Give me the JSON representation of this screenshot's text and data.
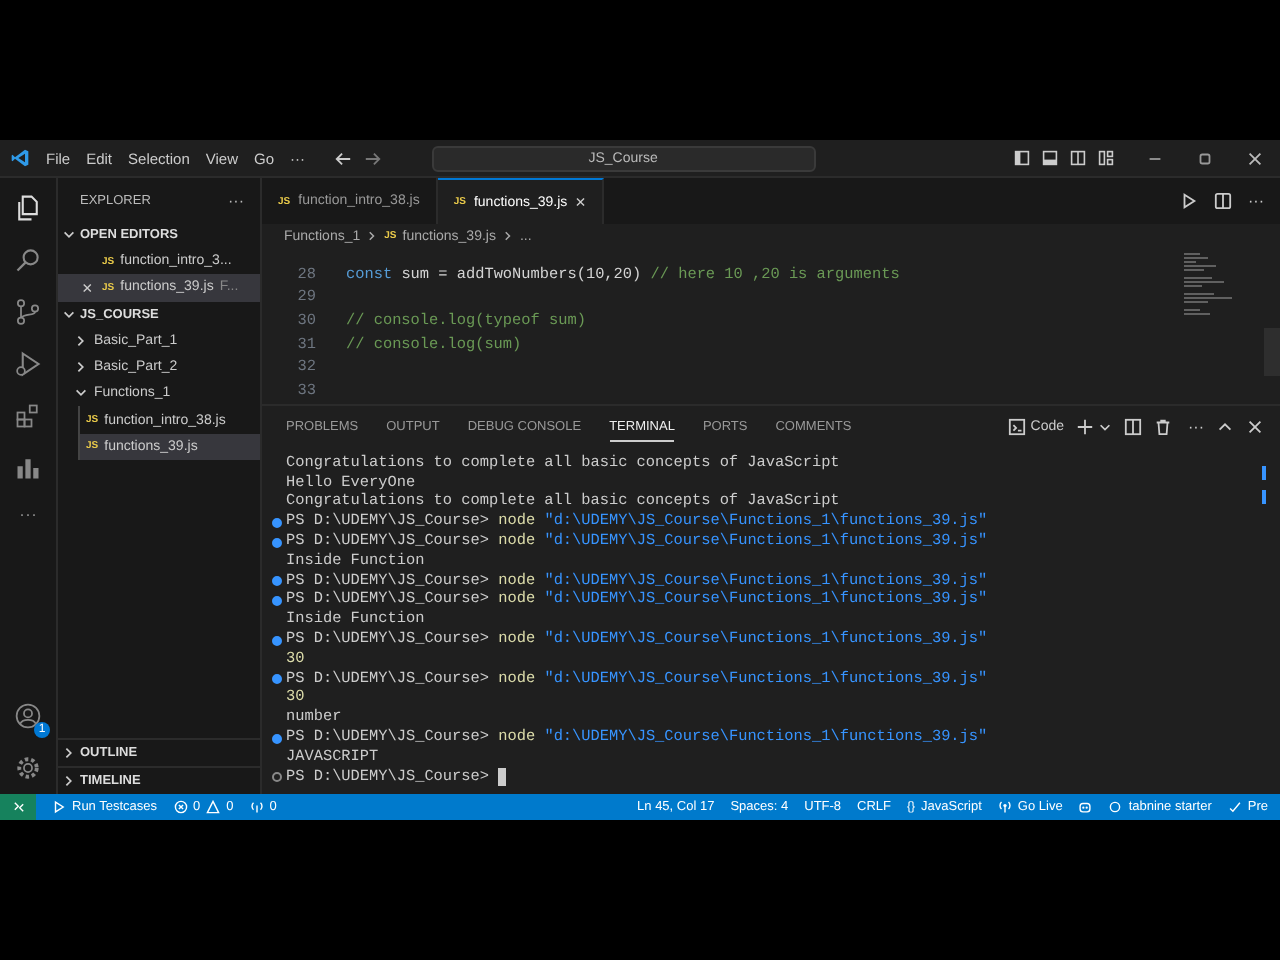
{
  "title_bar": {
    "menu": [
      "File",
      "Edit",
      "Selection",
      "View",
      "Go",
      "···"
    ],
    "search": "JS_Course"
  },
  "activity_more": "···",
  "sidebar": {
    "title": "EXPLORER",
    "more": "···",
    "sections": [
      {
        "label": "OPEN EDITORS",
        "expanded": true,
        "items": [
          {
            "icon": "JS",
            "name": "function_intro_3...",
            "selected": false
          },
          {
            "close": "×",
            "icon": "JS",
            "name": "functions_39.js",
            "detail": "F...",
            "selected": true
          }
        ]
      },
      {
        "label": "JS_COURSE",
        "expanded": true,
        "tree": [
          {
            "name": "Basic_Part_1",
            "kind": "folder",
            "expanded": false,
            "selected": false
          },
          {
            "name": "Basic_Part_2",
            "kind": "folder",
            "expanded": false,
            "selected": false
          },
          {
            "name": "Functions_1",
            "kind": "folder",
            "expanded": true,
            "selected": false,
            "children": [
              {
                "icon": "JS",
                "name": "function_intro_38.js",
                "kind": "file",
                "selected": false
              },
              {
                "icon": "JS",
                "name": "functions_39.js",
                "kind": "file",
                "selected": true
              }
            ]
          }
        ]
      }
    ],
    "bottom_sections": [
      {
        "label": "OUTLINE",
        "expanded": false
      },
      {
        "label": "TIMELINE",
        "expanded": false
      }
    ],
    "account_badge": "1"
  },
  "tabs": [
    {
      "icon": "JS",
      "label": "function_intro_38.js",
      "selected": false
    },
    {
      "icon": "JS",
      "label": "functions_39.js",
      "close": "×",
      "selected": true
    }
  ],
  "tab_bar_more": "···",
  "breadcrumbs": {
    "folder": "Functions_1",
    "icon": "JS",
    "file": "functions_39.js",
    "more": "..."
  },
  "editor": {
    "lines": [
      {
        "number": "28",
        "tokens": [
          {
            "kind": "keyword",
            "text": "const"
          },
          {
            "kind": "plain",
            "text": " sum = addTwoNumbers(10,20) "
          },
          {
            "kind": "comment",
            "text": "// here 10 ,20 is arguments"
          }
        ]
      },
      {
        "number": "29"
      },
      {
        "number": "30",
        "tokens": [
          {
            "kind": "comment",
            "text": "// console.log(typeof sum)"
          }
        ]
      },
      {
        "number": "31",
        "tokens": [
          {
            "kind": "comment",
            "text": "// console.log(sum)"
          }
        ]
      },
      {
        "number": "32"
      },
      {
        "number": "33"
      }
    ]
  },
  "panel": {
    "tabs": [
      {
        "label": "PROBLEMS",
        "selected": false
      },
      {
        "label": "OUTPUT",
        "selected": false
      },
      {
        "label": "DEBUG CONSOLE",
        "selected": false
      },
      {
        "label": "TERMINAL",
        "selected": true
      },
      {
        "label": "PORTS",
        "selected": false
      },
      {
        "label": "COMMENTS",
        "selected": false
      }
    ],
    "terminal_name": "Code",
    "more": "···",
    "terminal": [
      {
        "kind": "output",
        "text": "Congratulations to complete all basic concepts of JavaScript"
      },
      {
        "kind": "output",
        "text": "Hello EveryOne"
      },
      {
        "kind": "output",
        "text": "Congratulations to complete all basic concepts of JavaScript"
      },
      {
        "kind": "prompt",
        "done": true,
        "prompt": "PS D:\\UDEMY\\JS_Course>",
        "command": "node",
        "argument": "\"d:\\UDEMY\\JS_Course\\Functions_1\\functions_39.js\""
      },
      {
        "kind": "prompt",
        "done": true,
        "prompt": "PS D:\\UDEMY\\JS_Course>",
        "command": "node",
        "argument": "\"d:\\UDEMY\\JS_Course\\Functions_1\\functions_39.js\""
      },
      {
        "kind": "output",
        "text": "Inside Function"
      },
      {
        "kind": "prompt",
        "done": true,
        "prompt": "PS D:\\UDEMY\\JS_Course>",
        "command": "node",
        "argument": "\"d:\\UDEMY\\JS_Course\\Functions_1\\functions_39.js\""
      },
      {
        "kind": "prompt",
        "done": true,
        "prompt": "PS D:\\UDEMY\\JS_Course>",
        "command": "node",
        "argument": "\"d:\\UDEMY\\JS_Course\\Functions_1\\functions_39.js\""
      },
      {
        "kind": "output",
        "text": "Inside Function"
      },
      {
        "kind": "prompt",
        "done": true,
        "prompt": "PS D:\\UDEMY\\JS_Course>",
        "command": "node",
        "argument": "\"d:\\UDEMY\\JS_Course\\Functions_1\\functions_39.js\""
      },
      {
        "kind": "number",
        "text": "30"
      },
      {
        "kind": "prompt",
        "done": true,
        "prompt": "PS D:\\UDEMY\\JS_Course>",
        "command": "node",
        "argument": "\"d:\\UDEMY\\JS_Course\\Functions_1\\functions_39.js\""
      },
      {
        "kind": "number",
        "text": "30"
      },
      {
        "kind": "output",
        "text": "number"
      },
      {
        "kind": "prompt",
        "done": true,
        "prompt": "PS D:\\UDEMY\\JS_Course>",
        "command": "node",
        "argument": "\"d:\\UDEMY\\JS_Course\\Functions_1\\functions_39.js\""
      },
      {
        "kind": "output",
        "text": "JAVASCRIPT"
      },
      {
        "kind": "prompt",
        "done": false,
        "prompt": "PS D:\\UDEMY\\JS_Course>",
        "cursor": true
      }
    ]
  },
  "status_bar": {
    "left": [
      {
        "kind": "runner",
        "text": "Run Testcases"
      },
      {
        "kind": "problems",
        "errors": "0",
        "warnings": "0"
      },
      {
        "kind": "ports",
        "text": "0"
      }
    ],
    "right": [
      {
        "kind": "plain",
        "text": "Ln 45, Col 17"
      },
      {
        "kind": "plain",
        "text": "Spaces: 4"
      },
      {
        "kind": "plain",
        "text": "UTF-8"
      },
      {
        "kind": "plain",
        "text": "CRLF"
      },
      {
        "kind": "language",
        "icon": "{}",
        "text": "JavaScript"
      },
      {
        "kind": "live",
        "text": "Go Live"
      },
      {
        "kind": "bot"
      },
      {
        "kind": "tabnine",
        "text": "tabnine starter"
      },
      {
        "kind": "prettier",
        "text": "Pre"
      }
    ]
  }
}
